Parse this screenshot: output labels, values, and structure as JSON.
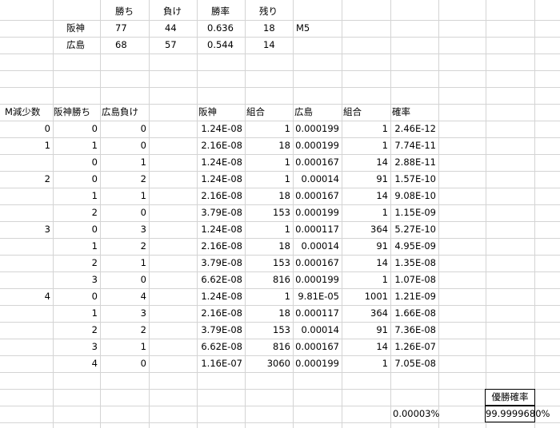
{
  "summary": {
    "headers": [
      "勝ち",
      "負け",
      "勝率",
      "残り"
    ],
    "rows": [
      {
        "team": "阪神",
        "wins": "77",
        "losses": "44",
        "rate": "0.636",
        "remaining": "18",
        "note": "M5"
      },
      {
        "team": "広島",
        "wins": "68",
        "losses": "57",
        "rate": "0.544",
        "remaining": "14",
        "note": ""
      }
    ]
  },
  "table": {
    "headers": [
      "M減少数",
      "阪神勝ち",
      "広島負け",
      "阪神",
      "組合",
      "広島",
      "組合",
      "確率"
    ],
    "rows": [
      [
        "0",
        "0",
        "0",
        "1.24E-08",
        "1",
        "0.000199",
        "1",
        "2.46E-12"
      ],
      [
        "1",
        "1",
        "0",
        "2.16E-08",
        "18",
        "0.000199",
        "1",
        "7.74E-11"
      ],
      [
        "",
        "0",
        "1",
        "1.24E-08",
        "1",
        "0.000167",
        "14",
        "2.88E-11"
      ],
      [
        "2",
        "0",
        "2",
        "1.24E-08",
        "1",
        "0.00014",
        "91",
        "1.57E-10"
      ],
      [
        "",
        "1",
        "1",
        "2.16E-08",
        "18",
        "0.000167",
        "14",
        "9.08E-10"
      ],
      [
        "",
        "2",
        "0",
        "3.79E-08",
        "153",
        "0.000199",
        "1",
        "1.15E-09"
      ],
      [
        "3",
        "0",
        "3",
        "1.24E-08",
        "1",
        "0.000117",
        "364",
        "5.27E-10"
      ],
      [
        "",
        "1",
        "2",
        "2.16E-08",
        "18",
        "0.00014",
        "91",
        "4.95E-09"
      ],
      [
        "",
        "2",
        "1",
        "3.79E-08",
        "153",
        "0.000167",
        "14",
        "1.35E-08"
      ],
      [
        "",
        "3",
        "0",
        "6.62E-08",
        "816",
        "0.000199",
        "1",
        "1.07E-08"
      ],
      [
        "4",
        "0",
        "4",
        "1.24E-08",
        "1",
        "9.81E-05",
        "1001",
        "1.21E-09"
      ],
      [
        "",
        "1",
        "3",
        "2.16E-08",
        "18",
        "0.000117",
        "364",
        "1.66E-08"
      ],
      [
        "",
        "2",
        "2",
        "3.79E-08",
        "153",
        "0.00014",
        "91",
        "7.36E-08"
      ],
      [
        "",
        "3",
        "1",
        "6.62E-08",
        "816",
        "0.000167",
        "14",
        "1.26E-07"
      ],
      [
        "",
        "4",
        "0",
        "1.16E-07",
        "3060",
        "0.000199",
        "1",
        "7.05E-08"
      ]
    ]
  },
  "footer": {
    "sum_percent": "0.00003%",
    "title": "優勝確率",
    "value": "99.9999680%"
  }
}
